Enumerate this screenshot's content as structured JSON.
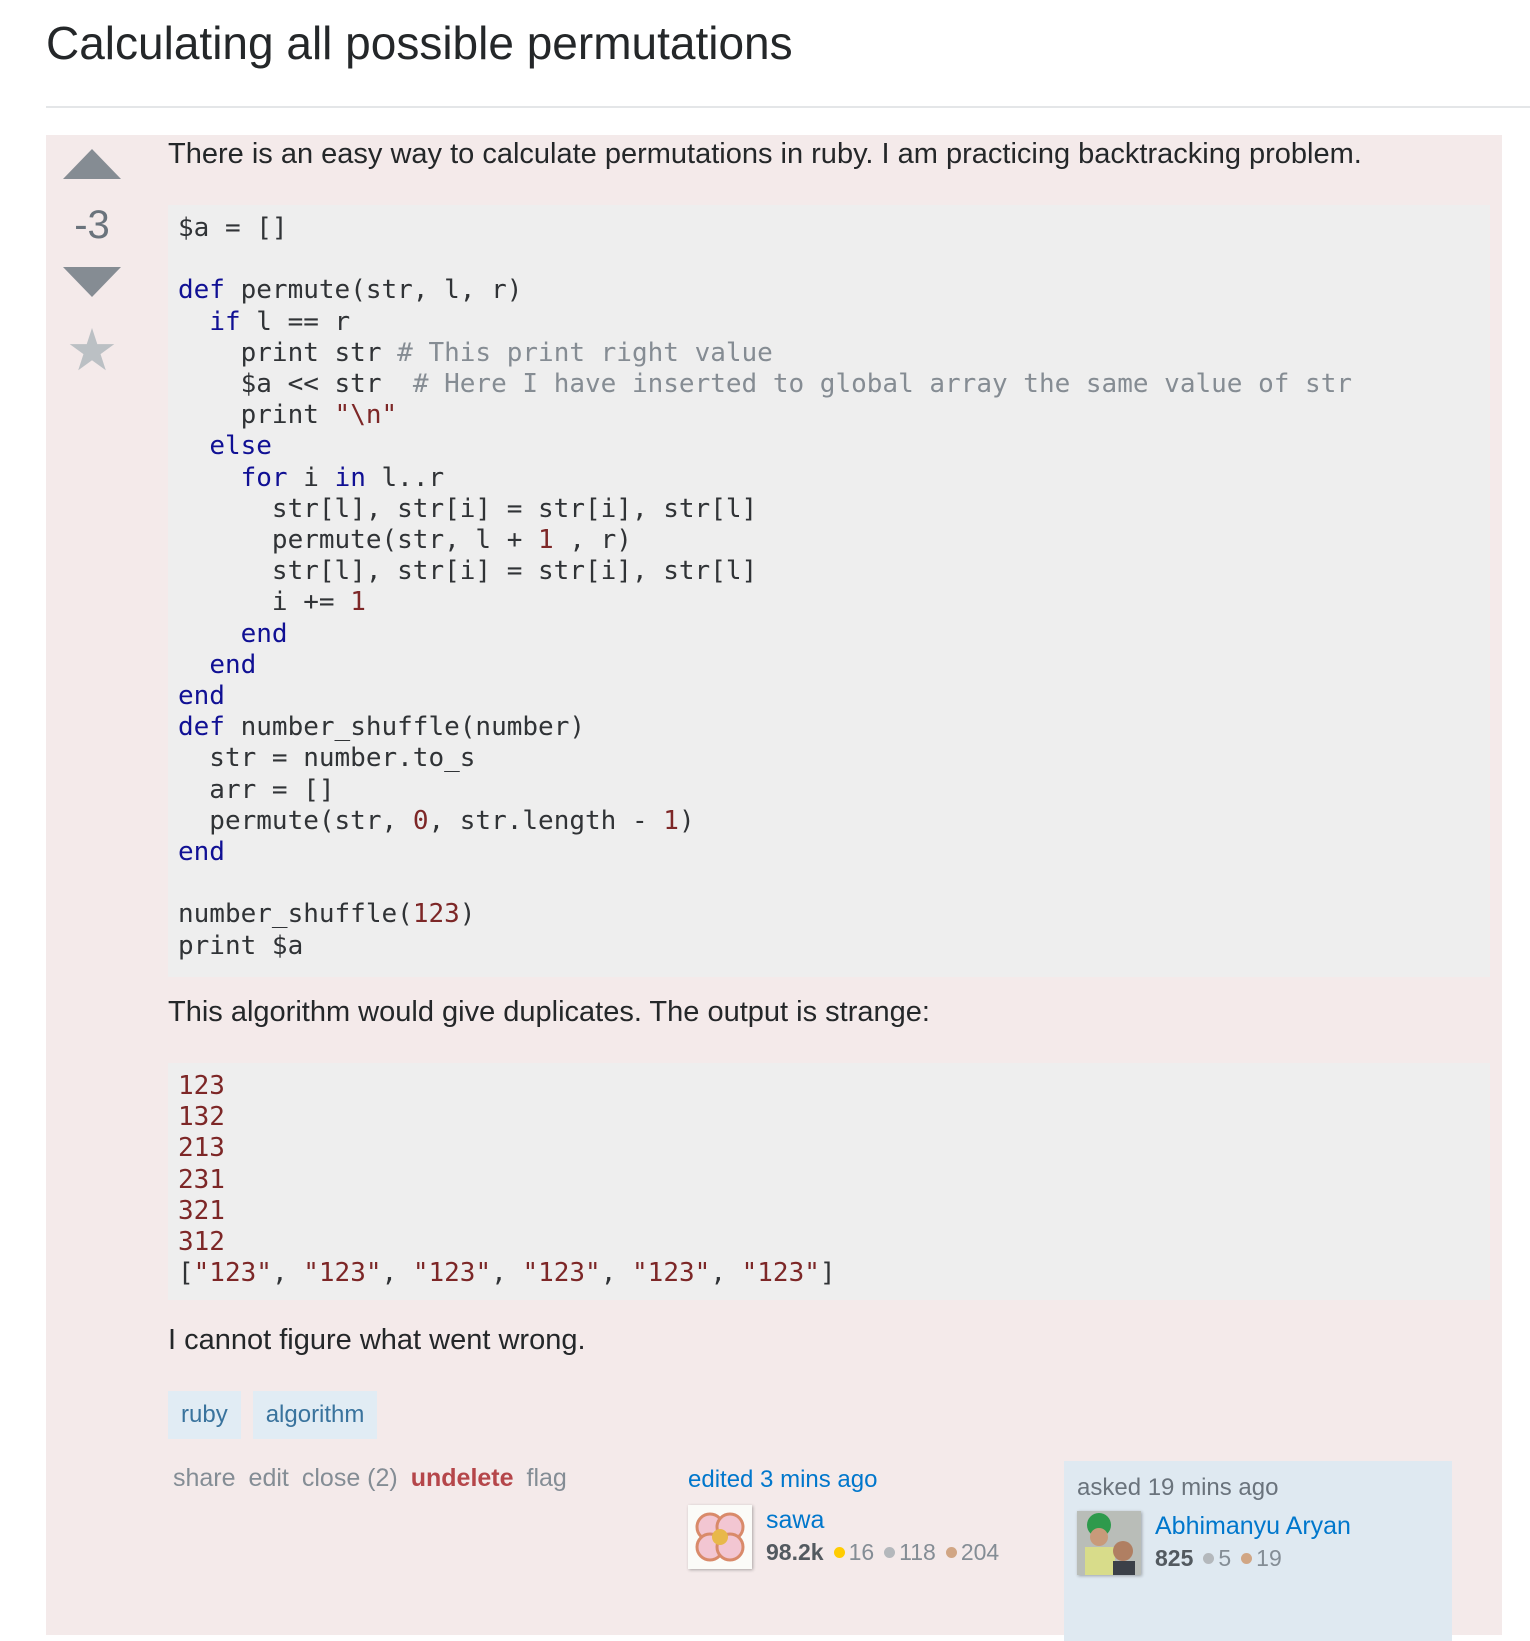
{
  "question": {
    "title": "Calculating all possible permutations",
    "vote_count": "-3",
    "icons": {
      "upvote": "triangle-up",
      "downvote": "triangle-down",
      "favorite": "star"
    },
    "body": {
      "intro": "There is an easy way to calculate permutations in ruby. I am practicing backtracking problem.",
      "code_lines": [
        [
          {
            "t": "pln",
            "v": "$a = []"
          }
        ],
        [],
        [
          {
            "t": "kw",
            "v": "def"
          },
          {
            "t": "pln",
            "v": " permute(str, l, r)"
          }
        ],
        [
          {
            "t": "pln",
            "v": "  "
          },
          {
            "t": "kw",
            "v": "if"
          },
          {
            "t": "pln",
            "v": " l == r"
          }
        ],
        [
          {
            "t": "pln",
            "v": "    print str "
          },
          {
            "t": "cm",
            "v": "# This print right value"
          }
        ],
        [
          {
            "t": "pln",
            "v": "    $a << str  "
          },
          {
            "t": "cm",
            "v": "# Here I have inserted to global array the same value of str"
          }
        ],
        [
          {
            "t": "pln",
            "v": "    print "
          },
          {
            "t": "lit",
            "v": "\"\\n\""
          }
        ],
        [
          {
            "t": "pln",
            "v": "  "
          },
          {
            "t": "kw",
            "v": "else"
          }
        ],
        [
          {
            "t": "pln",
            "v": "    "
          },
          {
            "t": "kw",
            "v": "for"
          },
          {
            "t": "pln",
            "v": " i "
          },
          {
            "t": "kw",
            "v": "in"
          },
          {
            "t": "pln",
            "v": " l..r"
          }
        ],
        [
          {
            "t": "pln",
            "v": "      str[l], str[i] = str[i], str[l]"
          }
        ],
        [
          {
            "t": "pln",
            "v": "      permute(str, l + "
          },
          {
            "t": "lit",
            "v": "1"
          },
          {
            "t": "pln",
            "v": " , r)"
          }
        ],
        [
          {
            "t": "pln",
            "v": "      str[l], str[i] = str[i], str[l]"
          }
        ],
        [
          {
            "t": "pln",
            "v": "      i += "
          },
          {
            "t": "lit",
            "v": "1"
          }
        ],
        [
          {
            "t": "pln",
            "v": "    "
          },
          {
            "t": "kw",
            "v": "end"
          }
        ],
        [
          {
            "t": "pln",
            "v": "  "
          },
          {
            "t": "kw",
            "v": "end"
          }
        ],
        [
          {
            "t": "kw",
            "v": "end"
          }
        ],
        [
          {
            "t": "kw",
            "v": "def"
          },
          {
            "t": "pln",
            "v": " number_shuffle(number)"
          }
        ],
        [
          {
            "t": "pln",
            "v": "  str = number.to_s"
          }
        ],
        [
          {
            "t": "pln",
            "v": "  arr = []"
          }
        ],
        [
          {
            "t": "pln",
            "v": "  permute(str, "
          },
          {
            "t": "lit",
            "v": "0"
          },
          {
            "t": "pln",
            "v": ", str.length - "
          },
          {
            "t": "lit",
            "v": "1"
          },
          {
            "t": "pln",
            "v": ")"
          }
        ],
        [
          {
            "t": "kw",
            "v": "end"
          }
        ],
        [],
        [
          {
            "t": "pln",
            "v": "number_shuffle("
          },
          {
            "t": "lit",
            "v": "123"
          },
          {
            "t": "pln",
            "v": ")"
          }
        ],
        [
          {
            "t": "pln",
            "v": "print $a"
          }
        ]
      ],
      "middle": "This algorithm would give duplicates. The output is strange:",
      "output_lines": [
        [
          {
            "t": "lit",
            "v": "123"
          }
        ],
        [
          {
            "t": "lit",
            "v": "132"
          }
        ],
        [
          {
            "t": "lit",
            "v": "213"
          }
        ],
        [
          {
            "t": "lit",
            "v": "231"
          }
        ],
        [
          {
            "t": "lit",
            "v": "321"
          }
        ],
        [
          {
            "t": "lit",
            "v": "312"
          }
        ],
        [
          {
            "t": "pln",
            "v": "["
          },
          {
            "t": "lit",
            "v": "\"123\""
          },
          {
            "t": "pln",
            "v": ", "
          },
          {
            "t": "lit",
            "v": "\"123\""
          },
          {
            "t": "pln",
            "v": ", "
          },
          {
            "t": "lit",
            "v": "\"123\""
          },
          {
            "t": "pln",
            "v": ", "
          },
          {
            "t": "lit",
            "v": "\"123\""
          },
          {
            "t": "pln",
            "v": ", "
          },
          {
            "t": "lit",
            "v": "\"123\""
          },
          {
            "t": "pln",
            "v": ", "
          },
          {
            "t": "lit",
            "v": "\"123\""
          },
          {
            "t": "pln",
            "v": "]"
          }
        ]
      ],
      "closing": "I cannot figure what went wrong."
    },
    "tags": [
      "ruby",
      "algorithm"
    ],
    "actions": {
      "share": "share",
      "edit": "edit",
      "close": "close (2)",
      "undelete": "undelete",
      "flag": "flag"
    },
    "edited": {
      "time_label": "edited 3 mins ago",
      "user_name": "sawa",
      "reputation": "98.2k",
      "gold": "16",
      "silver": "118",
      "bronze": "204"
    },
    "owner": {
      "time_label": "asked 19 mins ago",
      "user_name": "Abhimanyu Aryan",
      "reputation": "825",
      "silver": "5",
      "bronze": "19"
    },
    "colors": {
      "post_bg": "#f4eaea",
      "code_bg": "#eeeeee",
      "keyword": "#101094",
      "comment": "#858c93",
      "literal": "#7d2727",
      "link": "#0077cc",
      "tag_bg": "#e1ecf4",
      "tag_text": "#39739d",
      "undelete": "#b5464a",
      "owner_bg": "#dfe9f1"
    }
  }
}
